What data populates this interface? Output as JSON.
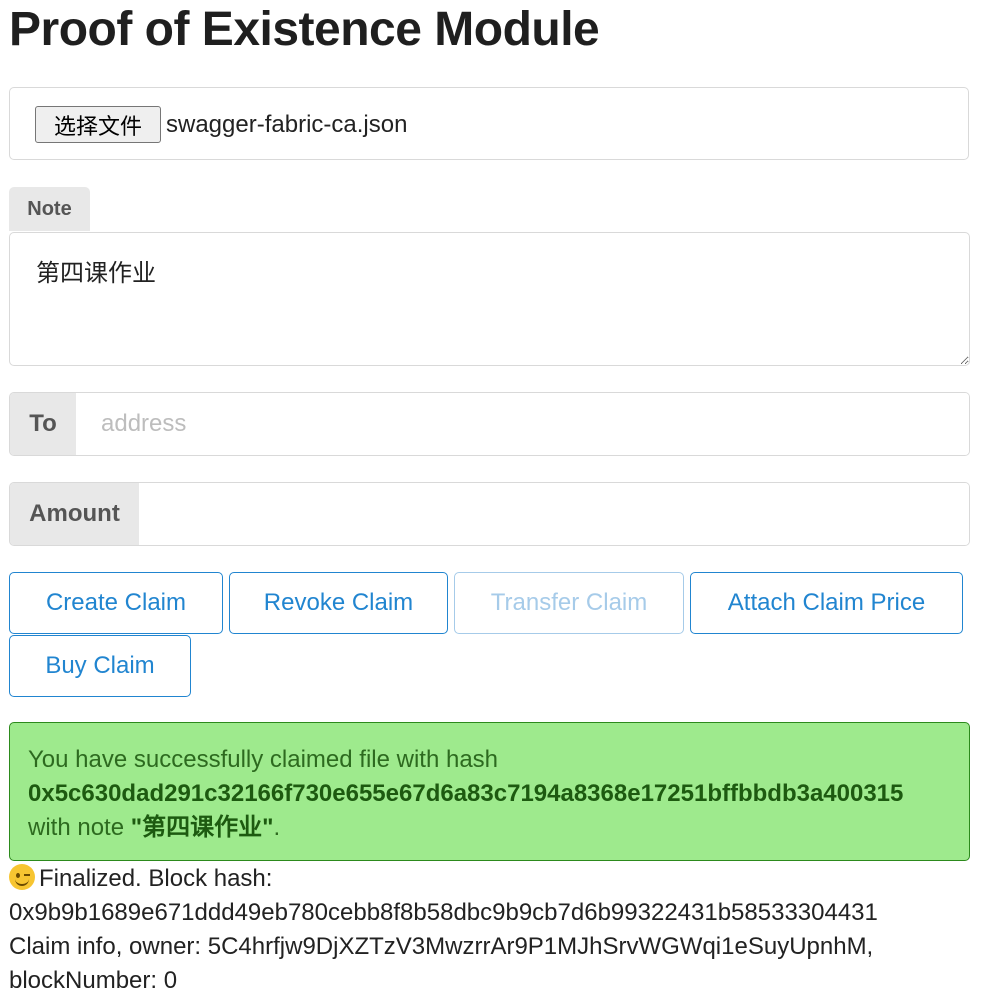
{
  "page": {
    "title": "Proof of Existence Module"
  },
  "file": {
    "button_label": "选择文件",
    "file_name": "swagger-fabric-ca.json"
  },
  "note": {
    "label": "Note",
    "value": "第四课作业"
  },
  "to": {
    "label": "To",
    "placeholder": "address",
    "value": ""
  },
  "amount": {
    "label": "Amount",
    "value": ""
  },
  "buttons": {
    "create": "Create Claim",
    "revoke": "Revoke Claim",
    "transfer": "Transfer Claim",
    "attach_price": "Attach Claim Price",
    "buy": "Buy Claim"
  },
  "message": {
    "prefix": "You have successfully claimed file with hash",
    "hash": "0x5c630dad291c32166f730e655e67d6a83c7194a8368e17251bffbbdb3a400315",
    "note_prefix": "with note ",
    "note_value": "\"第四课作业\"",
    "note_suffix": "."
  },
  "status": {
    "emoji_icon": "winking-face-icon",
    "finalized_text": "Finalized. Block hash:",
    "block_hash": "0x9b9b1689e671ddd49eb780cebb8f8b58dbc9b9cb7d6b99322431b58533304431",
    "claim_info": "Claim info, owner: 5C4hrfjw9DjXZTzV3MwzrrAr9P1MJhSrvWGWqi1eSuyUpnhM,",
    "block_number": "blockNumber: 0"
  },
  "colors": {
    "accent": "#2185d0",
    "success_bg": "#9eea8d",
    "success_border": "#2c8a1c"
  }
}
